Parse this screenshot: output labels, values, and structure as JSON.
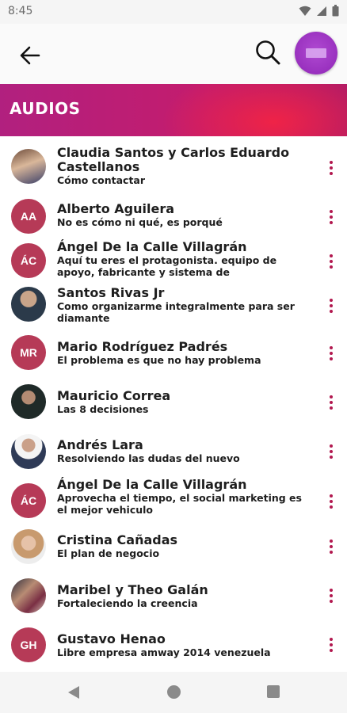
{
  "status": {
    "time": "8:45"
  },
  "app_bar": {
    "back_icon": "arrow-left-icon",
    "search_icon": "search-icon",
    "profile_icon": "profile-avatar"
  },
  "section": {
    "title": "AUDIOS",
    "colors": [
      "#b1207f",
      "#ef2347"
    ]
  },
  "accent_color": "#b2184f",
  "items": [
    {
      "title": "Claudia Santos y Carlos Eduardo Castellanos",
      "subtitle": "Cómo contactar",
      "avatar": "photo"
    },
    {
      "title": "Alberto Aguilera",
      "subtitle": "No es cómo ni qué, es porqué",
      "initials": "AA"
    },
    {
      "title": "Ángel De la Calle Villagrán",
      "subtitle": "Aquí tu eres el protagonista. equipo de apoyo, fabricante y sistema de",
      "initials": "ÁC"
    },
    {
      "title": "Santos Rivas Jr",
      "subtitle": "Como organizarme integralmente para ser diamante",
      "avatar": "photo"
    },
    {
      "title": "Mario Rodríguez Padrés",
      "subtitle": "El problema es que no hay problema",
      "initials": "MR"
    },
    {
      "title": "Mauricio Correa",
      "subtitle": "Las 8 decisiones",
      "avatar": "photo"
    },
    {
      "title": "Andrés Lara",
      "subtitle": "Resolviendo las dudas del nuevo",
      "avatar": "photo"
    },
    {
      "title": "Ángel De la Calle Villagrán",
      "subtitle": "Aprovecha el tiempo, el social marketing es el mejor vehiculo",
      "initials": "ÁC"
    },
    {
      "title": "Cristina Cañadas",
      "subtitle": "El plan de negocio",
      "avatar": "photo"
    },
    {
      "title": "Maribel y Theo Galán",
      "subtitle": "Fortaleciendo la creencia",
      "avatar": "photo"
    },
    {
      "title": "Gustavo Henao",
      "subtitle": "Libre empresa amway 2014 venezuela",
      "initials": "GH"
    }
  ],
  "nav": {
    "back": "nav-back-icon",
    "home": "nav-home-icon",
    "recents": "nav-recents-icon"
  }
}
